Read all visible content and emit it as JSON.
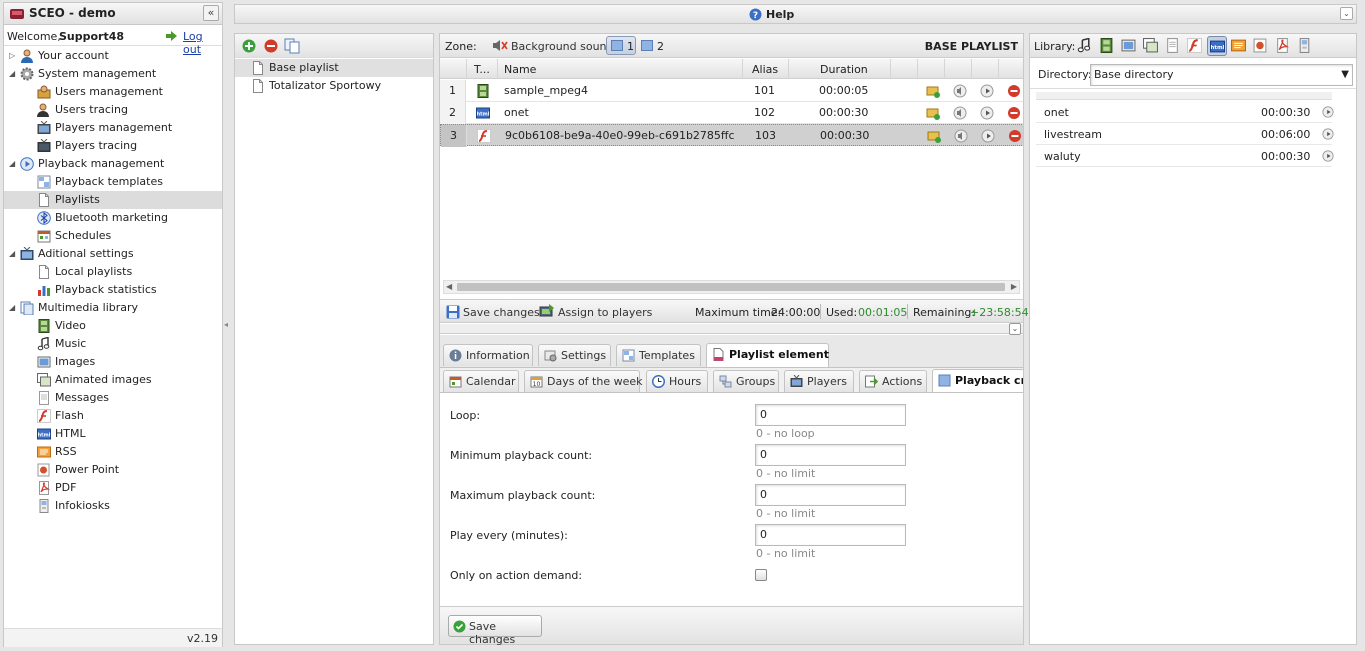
{
  "app": {
    "title": "SCEO - demo",
    "version": "v2.19"
  },
  "user": {
    "welcome": "Welcome,",
    "name": "Support48",
    "logout": "Log out"
  },
  "help": {
    "label": "Help"
  },
  "tree": [
    {
      "label": "Your account",
      "icon": "user-icon",
      "level": 0,
      "toggle": "▷"
    },
    {
      "label": "System management",
      "icon": "gear-icon",
      "level": 0,
      "toggle": "◢"
    },
    {
      "label": "Users management",
      "icon": "users-icon",
      "level": 1
    },
    {
      "label": "Users tracing",
      "icon": "user-trace-icon",
      "level": 1
    },
    {
      "label": "Players management",
      "icon": "tv-icon",
      "level": 1
    },
    {
      "label": "Players tracing",
      "icon": "tv-trace-icon",
      "level": 1
    },
    {
      "label": "Playback management",
      "icon": "play-circle-icon",
      "level": 0,
      "toggle": "◢"
    },
    {
      "label": "Playback templates",
      "icon": "template-icon",
      "level": 1
    },
    {
      "label": "Playlists",
      "icon": "document-icon",
      "level": 1,
      "selected": true
    },
    {
      "label": "Bluetooth marketing",
      "icon": "bluetooth-icon",
      "level": 1
    },
    {
      "label": "Schedules",
      "icon": "calendar-icon",
      "level": 1
    },
    {
      "label": "Aditional settings",
      "icon": "tv-settings-icon",
      "level": 0,
      "toggle": "◢"
    },
    {
      "label": "Local playlists",
      "icon": "document-icon",
      "level": 1
    },
    {
      "label": "Playback statistics",
      "icon": "bar-chart-icon",
      "level": 1
    },
    {
      "label": "Multimedia library",
      "icon": "library-icon",
      "level": 0,
      "toggle": "◢"
    },
    {
      "label": "Video",
      "icon": "film-icon",
      "level": 1
    },
    {
      "label": "Music",
      "icon": "music-note-icon",
      "level": 1
    },
    {
      "label": "Images",
      "icon": "image-icon",
      "level": 1
    },
    {
      "label": "Animated images",
      "icon": "animated-image-icon",
      "level": 1
    },
    {
      "label": "Messages",
      "icon": "message-icon",
      "level": 1
    },
    {
      "label": "Flash",
      "icon": "flash-icon",
      "level": 1
    },
    {
      "label": "HTML",
      "icon": "html-icon",
      "level": 1
    },
    {
      "label": "RSS",
      "icon": "rss-icon",
      "level": 1
    },
    {
      "label": "Power Point",
      "icon": "powerpoint-icon",
      "level": 1
    },
    {
      "label": "PDF",
      "icon": "pdf-icon",
      "level": 1
    },
    {
      "label": "Infokiosks",
      "icon": "kiosk-icon",
      "level": 1
    }
  ],
  "playlists": [
    {
      "label": "Base playlist",
      "selected": true
    },
    {
      "label": "Totalizator Sportowy"
    }
  ],
  "zone": {
    "label": "Zone:",
    "bg_sound": "Background sound",
    "zones": [
      "1",
      "2"
    ],
    "playlist_title": "BASE PLAYLIST"
  },
  "grid": {
    "headers": [
      "T...",
      "Name",
      "Alias",
      "Duration"
    ],
    "rows": [
      {
        "num": "1",
        "type": "film-icon",
        "name": "sample_mpeg4",
        "alias": "101",
        "duration": "00:00:05"
      },
      {
        "num": "2",
        "type": "html-icon",
        "name": "onet",
        "alias": "102",
        "duration": "00:00:30"
      },
      {
        "num": "3",
        "type": "flash-icon",
        "name": "9c0b6108-be9a-40e0-99eb-c691b2785ffc",
        "alias": "103",
        "duration": "00:00:30",
        "selected": true
      }
    ]
  },
  "status": {
    "save": "Save changes",
    "assign": "Assign to players",
    "max_label": "Maximum time:",
    "max_value": "24:00:00",
    "used_label": "Used:",
    "used_value": "00:01:05",
    "remaining_label": "Remaining:",
    "remaining_value": "+23:58:54",
    "used_color": "#2e8b2e"
  },
  "tabs_top": [
    {
      "label": "Information",
      "icon": "info-icon"
    },
    {
      "label": "Settings",
      "icon": "settings-icon"
    },
    {
      "label": "Templates",
      "icon": "template-icon"
    },
    {
      "label": "Playlist element",
      "icon": "document-icon",
      "active": true
    }
  ],
  "tabs_sub": [
    {
      "label": "Calendar",
      "icon": "calendar-icon"
    },
    {
      "label": "Days of the week",
      "icon": "calendar-week-icon"
    },
    {
      "label": "Hours",
      "icon": "clock-icon"
    },
    {
      "label": "Groups",
      "icon": "groups-icon"
    },
    {
      "label": "Players",
      "icon": "tv-icon"
    },
    {
      "label": "Actions",
      "icon": "action-icon"
    },
    {
      "label": "Playback cri",
      "icon": "criteria-icon",
      "active": true
    }
  ],
  "form": {
    "loop": {
      "label": "Loop:",
      "value": "0",
      "hint": "0 - no loop"
    },
    "min": {
      "label": "Minimum playback count:",
      "value": "0",
      "hint": "0 - no limit"
    },
    "max": {
      "label": "Maximum playback count:",
      "value": "0",
      "hint": "0 - no limit"
    },
    "every": {
      "label": "Play every (minutes):",
      "value": "0",
      "hint": "0 - no limit"
    },
    "action": {
      "label": "Only on action demand:"
    },
    "save": "Save changes"
  },
  "library": {
    "label": "Library:",
    "directory_label": "Directory:",
    "directory_value": "Base directory",
    "icons": [
      "music-note-icon",
      "film-icon",
      "image-icon",
      "animated-image-icon",
      "message-icon",
      "flash-icon",
      "html-icon",
      "rss-icon",
      "powerpoint-icon",
      "pdf-icon",
      "kiosk-icon"
    ],
    "items": [
      {
        "name": "onet",
        "duration": "00:00:30"
      },
      {
        "name": "livestream",
        "duration": "00:06:00"
      },
      {
        "name": "waluty",
        "duration": "00:00:30"
      }
    ]
  },
  "colors": {
    "accent": "#2a5db0",
    "selected_row": "#d0d0d0",
    "delete": "#d23a2a",
    "add": "#3aa03a"
  }
}
